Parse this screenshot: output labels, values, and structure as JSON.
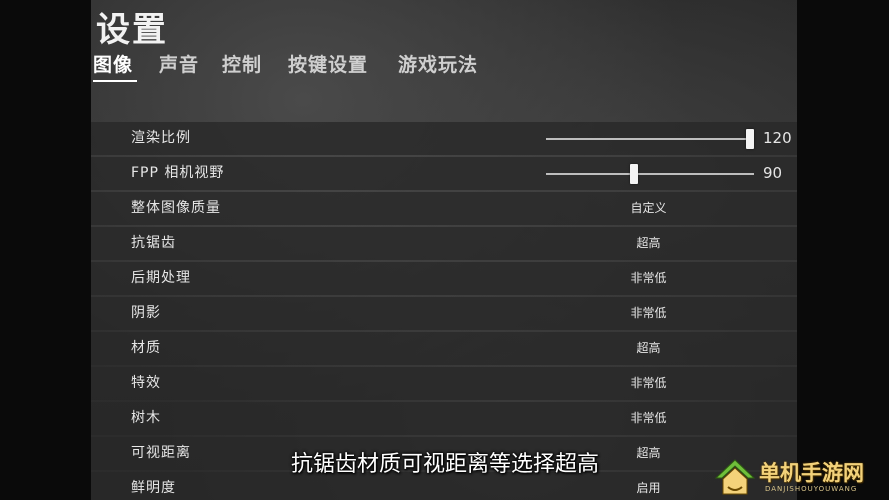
{
  "page": {
    "title": "设置"
  },
  "tabs": [
    {
      "label": "图像",
      "active": true
    },
    {
      "label": "声音",
      "active": false
    },
    {
      "label": "控制",
      "active": false
    },
    {
      "label": "按键设置",
      "active": false
    },
    {
      "label": "游戏玩法",
      "active": false
    }
  ],
  "settings": [
    {
      "label": "渲染比例",
      "type": "slider",
      "value": "120",
      "level": 1.0
    },
    {
      "label": "FPP 相机视野",
      "type": "slider",
      "value": "90",
      "level": 0.44
    },
    {
      "label": "整体图像质量",
      "type": "select",
      "value": "自定义"
    },
    {
      "label": "抗锯齿",
      "type": "select",
      "value": "超高"
    },
    {
      "label": "后期处理",
      "type": "select",
      "value": "非常低"
    },
    {
      "label": "阴影",
      "type": "select",
      "value": "非常低"
    },
    {
      "label": "材质",
      "type": "select",
      "value": "超高"
    },
    {
      "label": "特效",
      "type": "select",
      "value": "非常低"
    },
    {
      "label": "树木",
      "type": "select",
      "value": "非常低"
    },
    {
      "label": "可视距离",
      "type": "select",
      "value": "超高"
    },
    {
      "label": "鲜明度",
      "type": "select",
      "value": "启用"
    }
  ],
  "subtitle": "抗锯齿材质可视距离等选择超高",
  "watermark": {
    "text": "单机手游网",
    "subtext": "DANJISHOUYOUWANG"
  },
  "colors": {
    "background": "#2c2c2c",
    "row": "#282828",
    "text": "#e6e6e6",
    "watermark_gold": "#f3d27a",
    "watermark_green": "#6fbf3a"
  }
}
